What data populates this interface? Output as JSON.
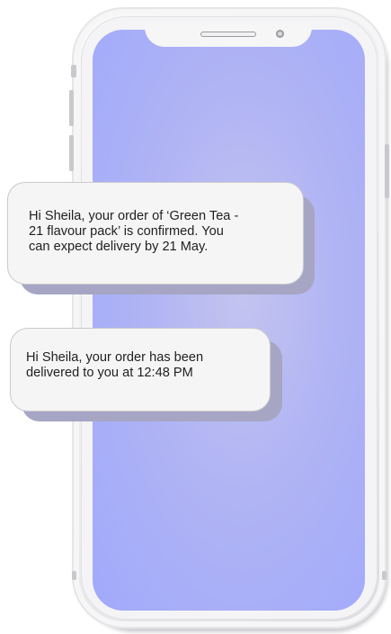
{
  "messages": [
    {
      "text": "Hi Sheila, your order of ‘Green Tea -\n21 flavour pack’ is confirmed. You\ncan expect delivery by 21 May."
    },
    {
      "text": "Hi Sheila, your order has been\ndelivered to you at 12:48 PM"
    }
  ],
  "colors": {
    "screen": "#a1a9fb",
    "bubble": "#f5f5f5",
    "bubble_shadow": "#a6a6c4",
    "text": "#1f1f1f"
  }
}
